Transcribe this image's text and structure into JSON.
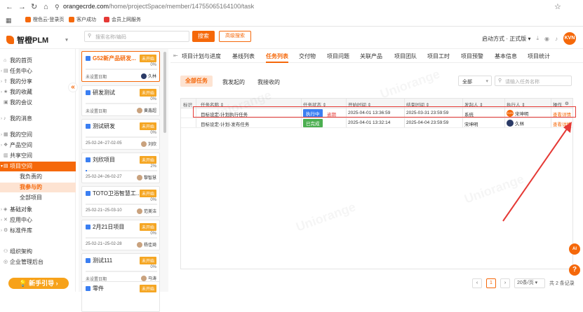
{
  "browser": {
    "url_host": "orangecrde.com",
    "url_path": "/home/projectSpace/member/14755065164100/task",
    "bookmarks": [
      "橙色云-登录页",
      "客户成功",
      "会员上网服务"
    ]
  },
  "header": {
    "logo": "智橙PLM",
    "search_placeholder": "搜索名称/编码",
    "search_button": "搜索",
    "advanced_search": "高级搜索",
    "mode": "启动方式 · 正式版",
    "user_avatar": "KVN"
  },
  "sidebar": {
    "items": [
      {
        "label": "我的首页",
        "icon": "home-icon"
      },
      {
        "label": "任务中心",
        "icon": "task-icon"
      },
      {
        "label": "我的分享",
        "icon": "share-icon"
      },
      {
        "label": "我的收藏",
        "icon": "star-icon"
      },
      {
        "label": "我的会议",
        "icon": "meeting-icon"
      },
      {
        "label": "我的消息",
        "icon": "bell-icon"
      },
      {
        "label": "我的空间",
        "icon": "space-icon"
      },
      {
        "label": "产品空间",
        "icon": "product-icon"
      },
      {
        "label": "共享空间",
        "icon": "shared-icon"
      },
      {
        "label": "项目空间",
        "icon": "project-icon"
      }
    ],
    "project_sub": [
      "我负责的",
      "我参与的",
      "全部项目"
    ],
    "items_bottom": [
      {
        "label": "基础对象",
        "icon": "object-icon"
      },
      {
        "label": "应用中心",
        "icon": "app-icon"
      },
      {
        "label": "标准件库",
        "icon": "library-icon"
      },
      {
        "label": "组织架构",
        "icon": "org-icon"
      },
      {
        "label": "企业管理后台",
        "icon": "admin-icon"
      }
    ],
    "guide_button": "新手引导"
  },
  "projects": [
    {
      "title": "G52新产品研发...",
      "status": "未开始",
      "pct": "0%",
      "progress": 0,
      "date": "未设置日期",
      "owner": "久林"
    },
    {
      "title": "研发测试",
      "status": "未开始",
      "pct": "0%",
      "progress": 0,
      "date": "未设置日期",
      "owner": "黄鑫超"
    },
    {
      "title": "测试研发",
      "status": "未开始",
      "pct": "0%",
      "progress": 0,
      "date": "25-02-24~27-02-05",
      "owner": "刘欣"
    },
    {
      "title": "刘欣项目",
      "status": "未开始",
      "pct": "2%",
      "progress": 0.02,
      "date": "25-02-24~26-02-27",
      "owner": "黎智慧"
    },
    {
      "title": "TOTO卫浴智慧工...",
      "status": "未开始",
      "pct": "0%",
      "progress": 0,
      "date": "25-02-21~25-03-10",
      "owner": "范美洁"
    },
    {
      "title": "2月21日项目",
      "status": "未开始",
      "pct": "0%",
      "progress": 0,
      "date": "25-02-21~25-02-28",
      "owner": "杨佳琦"
    },
    {
      "title": "测试111",
      "status": "未开始",
      "pct": "0%",
      "progress": 0,
      "date": "未设置日期",
      "owner": "马涛"
    },
    {
      "title": "零件",
      "status": "未开始",
      "pct": "",
      "progress": 0,
      "date": "",
      "owner": ""
    }
  ],
  "tabs": [
    "项目计划与进度",
    "基线列表",
    "任务列表",
    "交付物",
    "项目问题",
    "关联产品",
    "项目团队",
    "项目工时",
    "项目预警",
    "基本信息",
    "项目统计"
  ],
  "active_tab": "任务列表",
  "subtabs": [
    "全部任务",
    "我发起的",
    "我接收的"
  ],
  "filter": {
    "scope": "全部",
    "task_search_placeholder": "请输入任务名称"
  },
  "table": {
    "headers": [
      "标识",
      "任务名称 ⇕",
      "任务状态 ⇕",
      "开始时间 ⇕",
      "结束时间 ⇕",
      "发起人 ⇕",
      "执行人 ⇕",
      "操作"
    ],
    "rows": [
      {
        "name": "目标设定-计划执行任务",
        "status": "执行中",
        "status_color": "#3b7ff2",
        "overdue": "逾期",
        "start": "2025-04-01 13:36:59",
        "end": "2025-03-31 23:59:59",
        "initiator": "系统",
        "executor": "宋坤明",
        "exec_avatar": "KVN",
        "action": "查看详情"
      },
      {
        "name": "目标设定-计划-发布任务",
        "status": "已完成",
        "status_color": "#4caf50",
        "overdue": "",
        "start": "2025-04-01 13:32:14",
        "end": "2025-04-04 23:59:59",
        "initiator": "宋坤明",
        "executor": "久林",
        "exec_avatar": "",
        "action": "查看详情"
      }
    ]
  },
  "pager": {
    "page": "1",
    "page_size": "20条/页",
    "total": "共 2 条记录"
  },
  "floats": {
    "ai": "AI",
    "help": "?"
  },
  "watermark": "Uniorange"
}
